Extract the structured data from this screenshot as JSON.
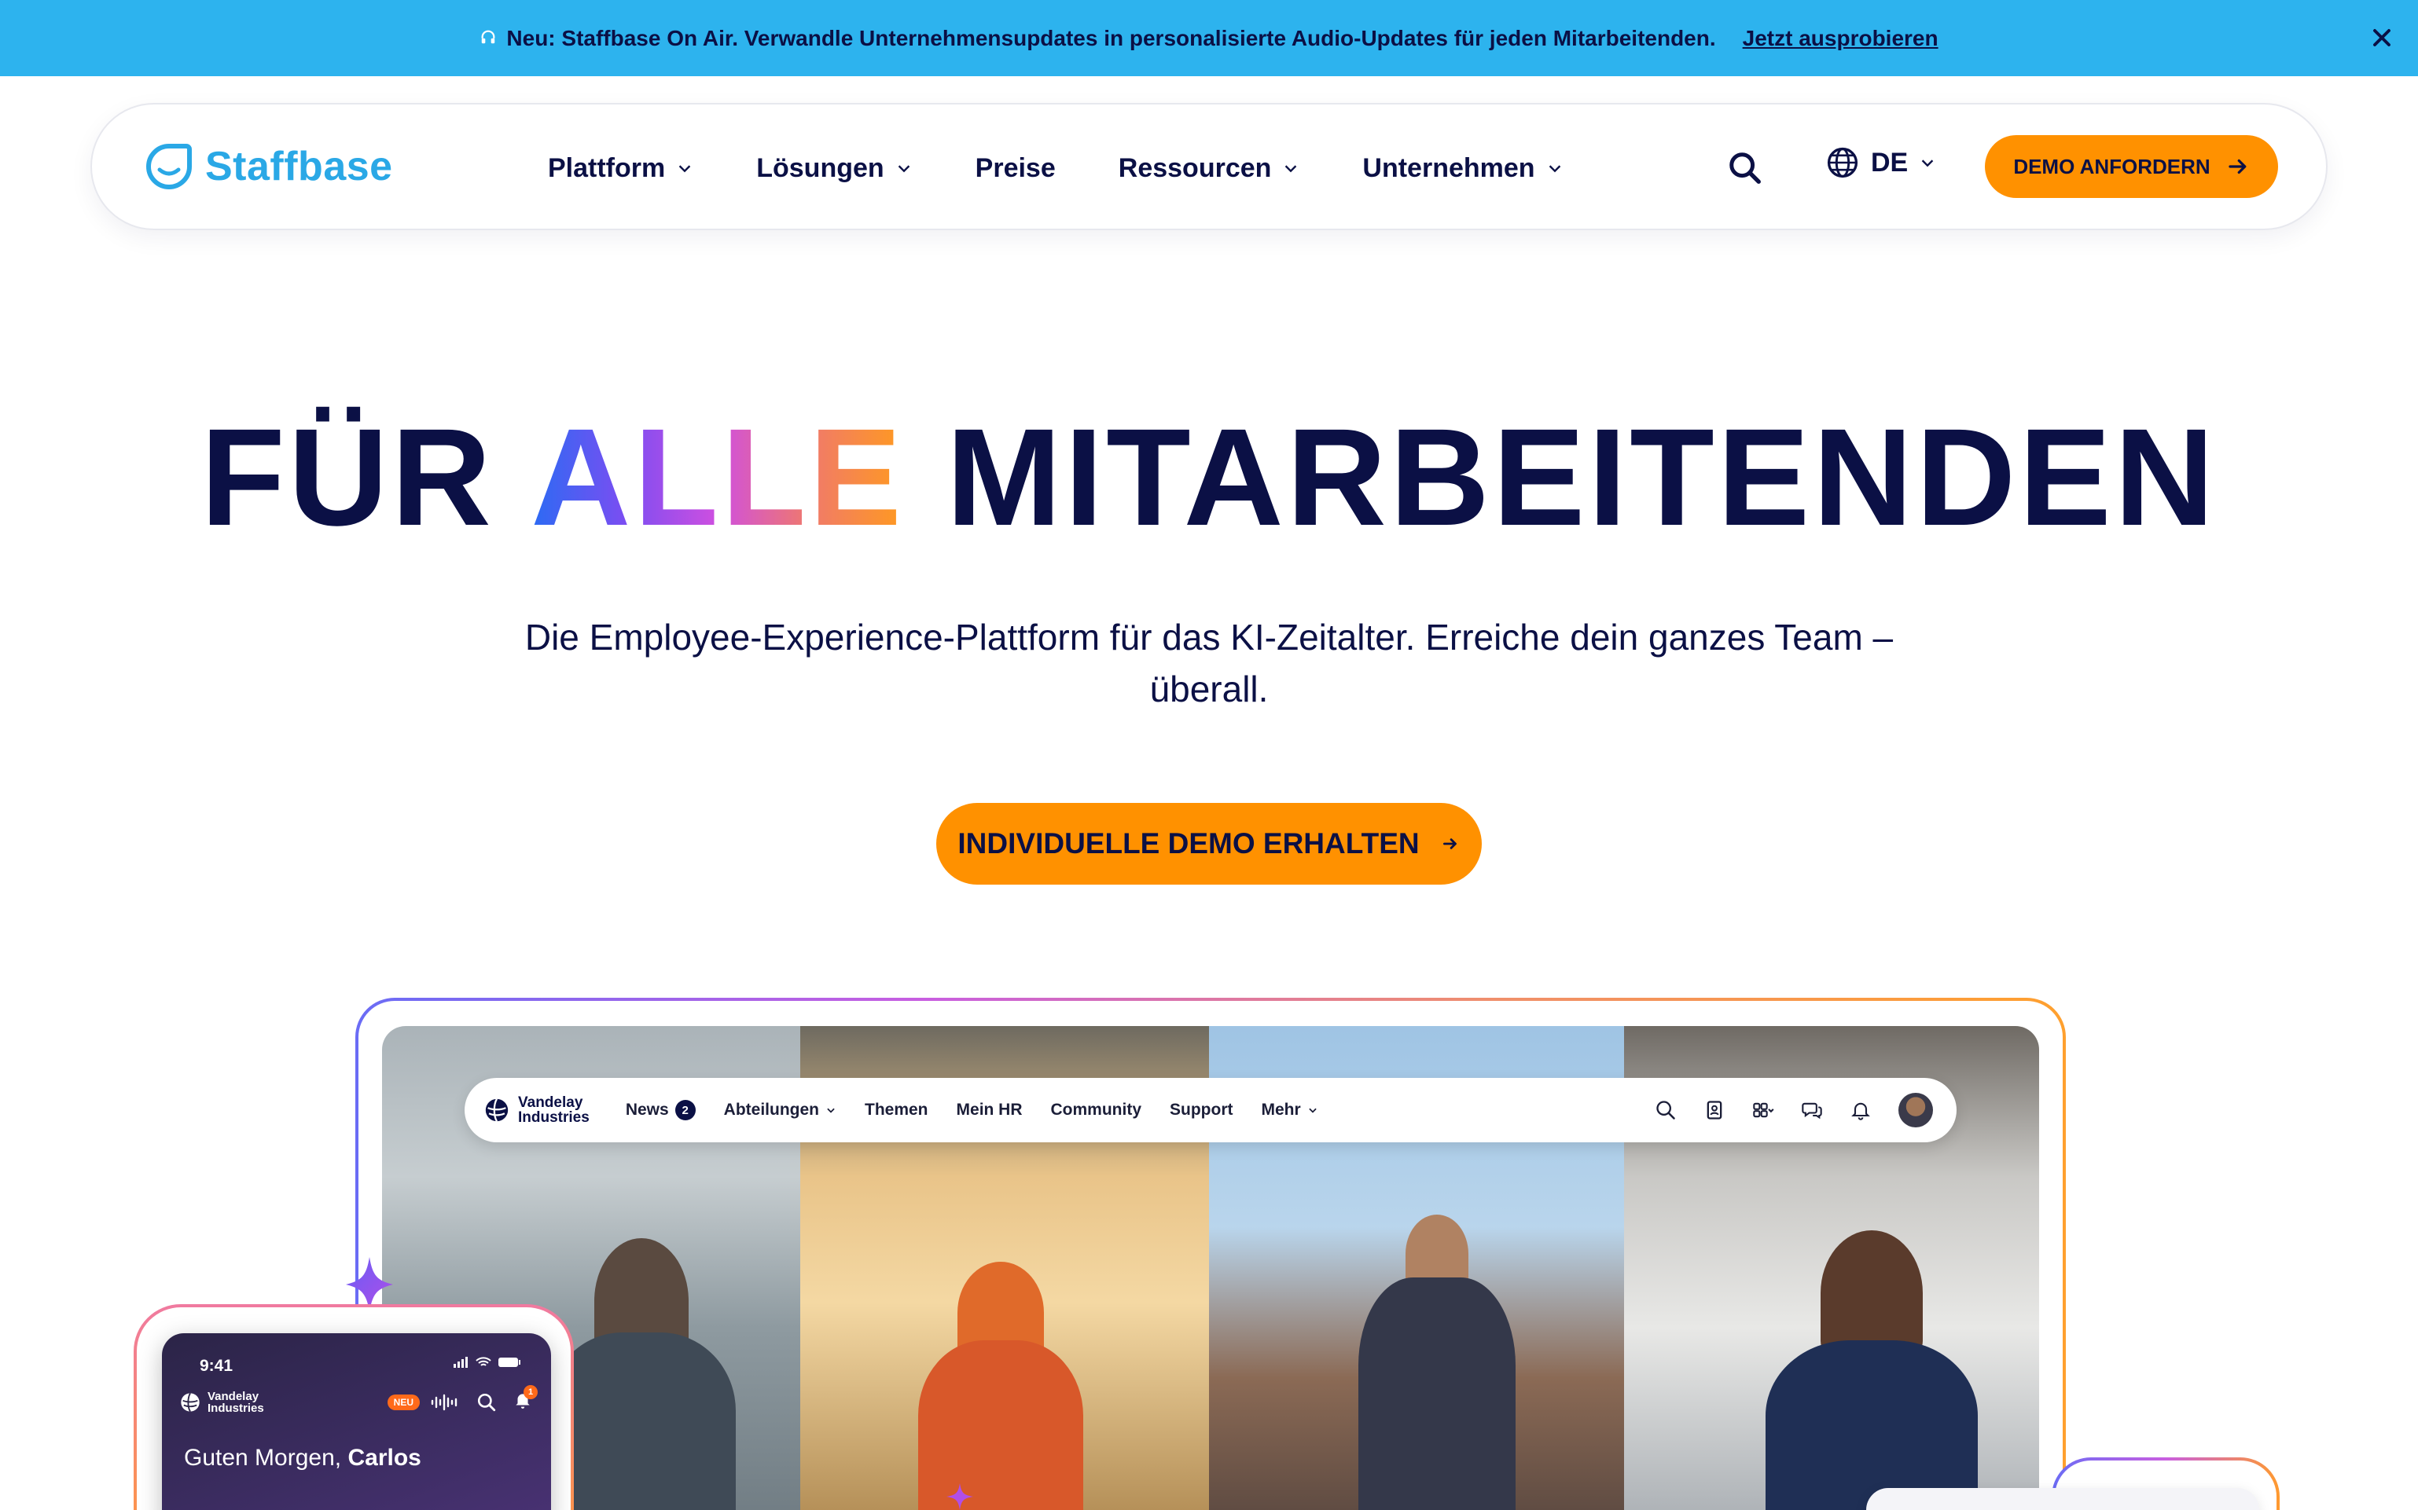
{
  "announcement": {
    "text": "Neu: Staffbase On Air. Verwandle Unternehmensupdates in personalisierte Audio-Updates für jeden Mitarbeitenden.",
    "cta": "Jetzt ausprobieren"
  },
  "nav": {
    "logo": "Staffbase",
    "items": [
      {
        "label": "Plattform",
        "dropdown": true
      },
      {
        "label": "Lösungen",
        "dropdown": true
      },
      {
        "label": "Preise",
        "dropdown": false
      },
      {
        "label": "Ressourcen",
        "dropdown": true
      },
      {
        "label": "Unternehmen",
        "dropdown": true
      }
    ],
    "language": "DE",
    "demo_button": "DEMO ANFORDERN"
  },
  "hero": {
    "title_part1": "FÜR",
    "title_highlight": "ALLE",
    "title_part2": "MITARBEITENDEN",
    "subtitle": "Die Employee-Experience-Plattform für das KI-Zeitalter. Erreiche dein ganzes Team – überall.",
    "cta": "INDIVIDUELLE DEMO ERHALTEN"
  },
  "intranet": {
    "brand_line1": "Vandelay",
    "brand_line2": "Industries",
    "menu": [
      {
        "label": "News",
        "badge": "2"
      },
      {
        "label": "Abteilungen",
        "dropdown": true
      },
      {
        "label": "Themen"
      },
      {
        "label": "Mein HR"
      },
      {
        "label": "Community"
      },
      {
        "label": "Support"
      },
      {
        "label": "Mehr",
        "dropdown": true
      }
    ]
  },
  "phone": {
    "time": "9:41",
    "brand_line1": "Vandelay",
    "brand_line2": "Industries",
    "new_badge": "NEU",
    "notification_count": "1",
    "greeting": "Guten Morgen,",
    "name": "Carlos"
  },
  "colors": {
    "announce_bg": "#2db3ee",
    "brand_blue": "#2aa8e6",
    "accent_orange": "#ff9100",
    "text_navy": "#0b1045"
  }
}
